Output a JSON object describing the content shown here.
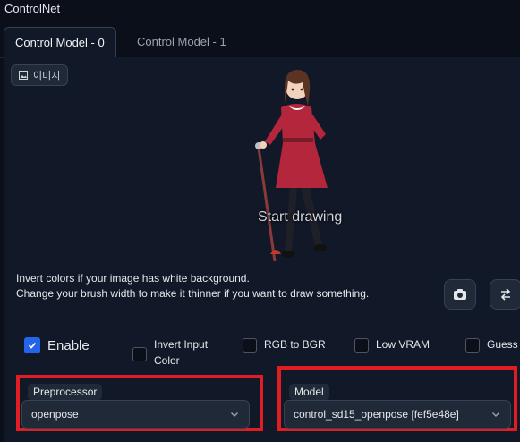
{
  "header": {
    "title": "ControlNet"
  },
  "tabs": [
    {
      "label": "Control Model - 0",
      "active": true
    },
    {
      "label": "Control Model - 1",
      "active": false
    }
  ],
  "image_input": {
    "badge_label": "이미지",
    "overlay_text": "Start drawing"
  },
  "hint": {
    "line1": "Invert colors if your image has white background.",
    "line2": "Change your brush width to make it thinner if you want to draw something."
  },
  "buttons": {
    "camera_icon": "camera-icon",
    "swap_icon": "swap-icon"
  },
  "checkboxes": {
    "enable": {
      "label": "Enable",
      "checked": true
    },
    "invert": {
      "label": "Invert Input Color",
      "line1": "Invert Input",
      "line2": "Color",
      "checked": false
    },
    "rgb_to_bgr": {
      "label": "RGB to BGR",
      "checked": false
    },
    "low_vram": {
      "label": "Low VRAM",
      "checked": false
    },
    "guess": {
      "label": "Guess M",
      "checked": false
    }
  },
  "preprocessor": {
    "label": "Preprocessor",
    "value": "openpose"
  },
  "model": {
    "label": "Model",
    "value": "control_sd15_openpose [fef5e48e]"
  },
  "colors": {
    "accent": "#2563eb",
    "highlight": "#e11d24",
    "background": "#0b0f19",
    "panel": "#111827"
  }
}
